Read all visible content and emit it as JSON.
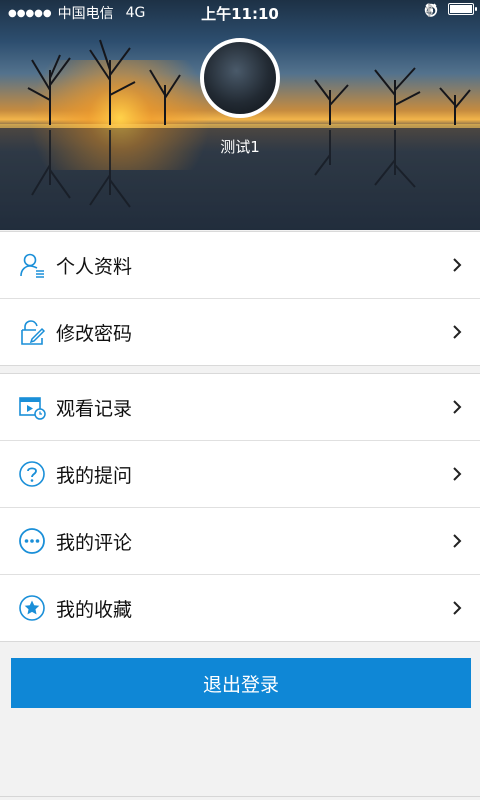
{
  "status_bar": {
    "signal": "●●●●●",
    "carrier": "中国电信",
    "network": "4G",
    "time": "上午11:10"
  },
  "profile": {
    "username": "测试1"
  },
  "menu_group_1": [
    {
      "label": "个人资料",
      "icon": "user-profile-icon"
    },
    {
      "label": "修改密码",
      "icon": "lock-edit-icon"
    }
  ],
  "menu_group_2": [
    {
      "label": "观看记录",
      "icon": "video-history-icon"
    },
    {
      "label": "我的提问",
      "icon": "question-icon"
    },
    {
      "label": "我的评论",
      "icon": "comment-icon"
    },
    {
      "label": "我的收藏",
      "icon": "star-icon"
    }
  ],
  "logout_label": "退出登录",
  "colors": {
    "accent": "#0f87d6",
    "icon": "#1a8fd8"
  }
}
